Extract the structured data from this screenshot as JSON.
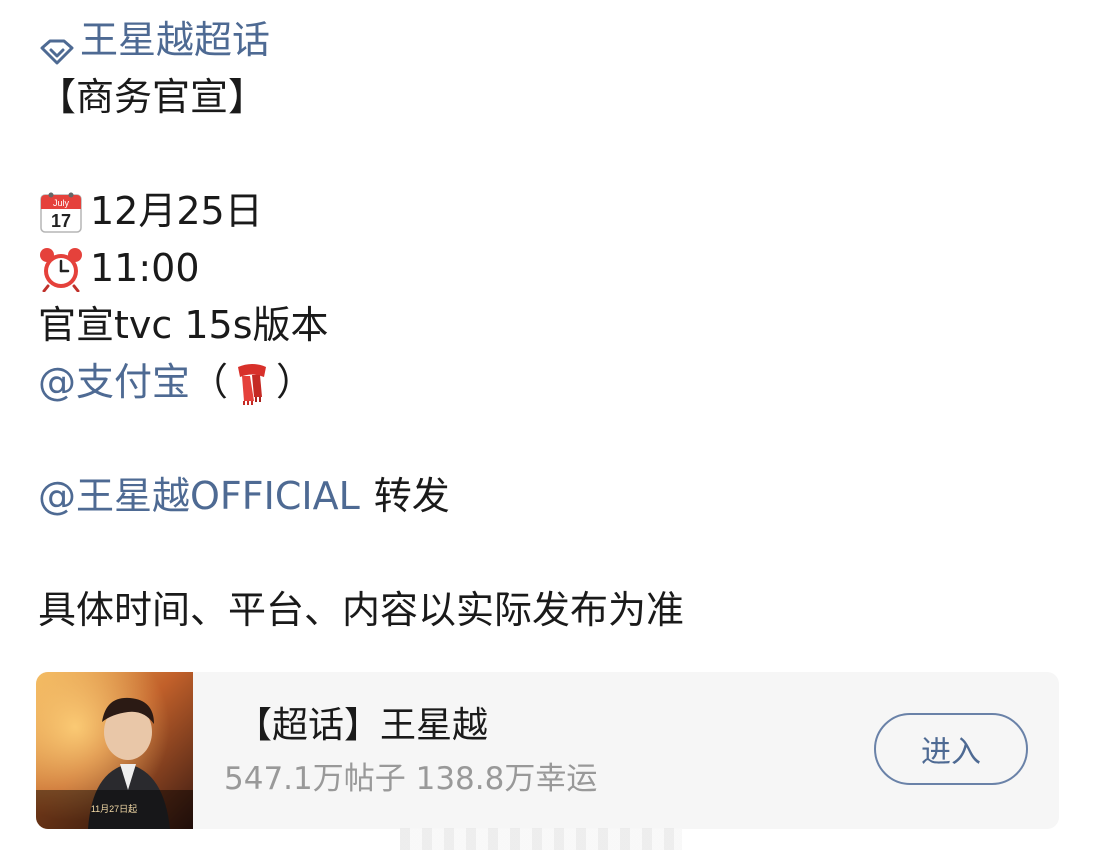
{
  "post": {
    "topic": "王星越超话",
    "category": "【商务官宣】",
    "date": "12月25日",
    "time": "11:00",
    "calendar_month": "July",
    "calendar_day": "17",
    "content_line": "官宣tvc 15s版本",
    "mention_brand": "@支付宝",
    "paren_open": "（",
    "paren_close": "）",
    "mention_official": "@王星越OFFICIAL",
    "repost_label": "转发",
    "disclaimer": "具体时间、平台、内容以实际发布为准"
  },
  "card": {
    "title": "【超话】王星越",
    "stats": "547.1万帖子 138.8万幸运",
    "enter_label": "进入",
    "poster_date": "11月27日起"
  },
  "colors": {
    "link": "#4e6a93",
    "muted": "#999999",
    "card_bg": "#f6f6f6"
  },
  "icons": [
    "diamond-icon",
    "calendar-icon",
    "alarm-clock-icon",
    "scarf-icon"
  ]
}
